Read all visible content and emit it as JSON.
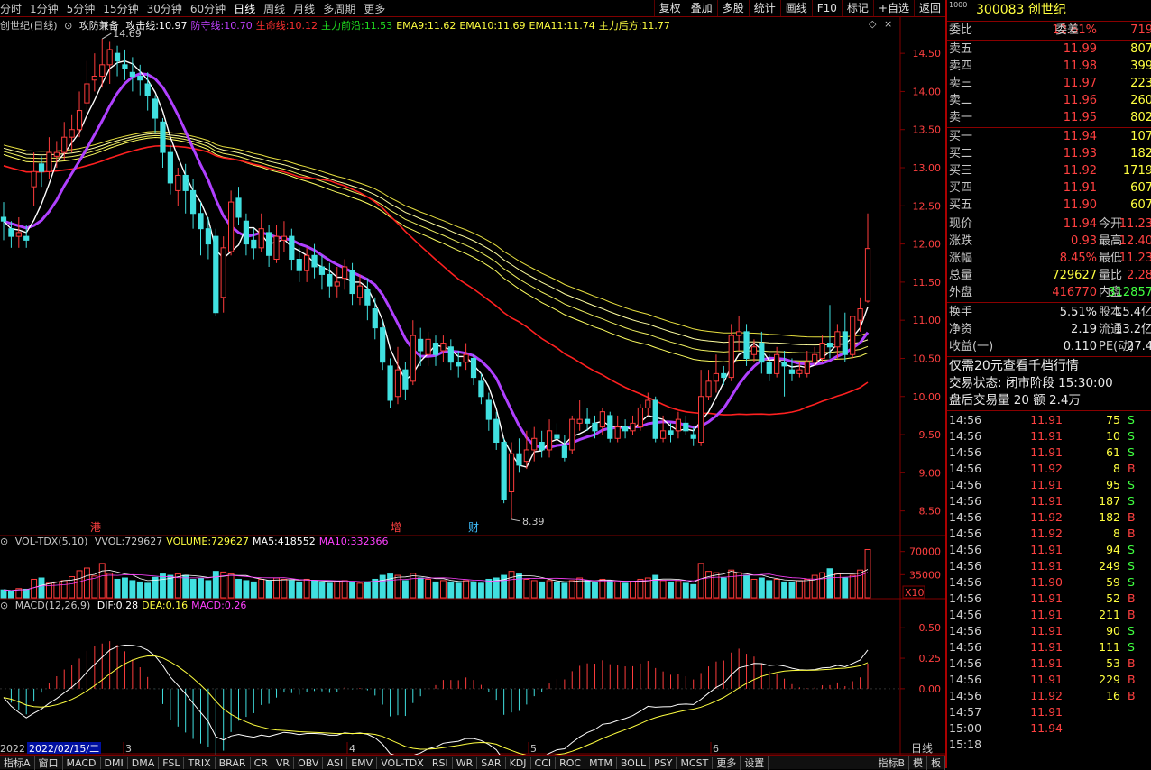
{
  "toolbar": {
    "periods": [
      "分时",
      "1分钟",
      "5分钟",
      "15分钟",
      "30分钟",
      "60分钟",
      "日线",
      "周线",
      "月线",
      "多周期",
      "更多"
    ],
    "active_period": "日线",
    "actions": [
      "复权",
      "叠加",
      "多股",
      "统计",
      "画线",
      "F10",
      "标记",
      "+自选",
      "返回"
    ]
  },
  "indicator_line": {
    "stock": "创世纪(日线)",
    "formula": "攻防兼备",
    "items": [
      {
        "label": "攻击线:",
        "value": "10.97",
        "color": "#ffffff"
      },
      {
        "label": "防守线:",
        "value": "10.70",
        "color": "#c040ff"
      },
      {
        "label": "生命线:",
        "value": "10.12",
        "color": "#ff3030"
      },
      {
        "label": "主力前沿:",
        "value": "11.53",
        "color": "#20e020"
      },
      {
        "label": "EMA9:",
        "value": "11.62",
        "color": "#ffff40"
      },
      {
        "label": "EMA10:",
        "value": "11.69",
        "color": "#ffff40"
      },
      {
        "label": "EMA11:",
        "value": "11.74",
        "color": "#ffff40"
      },
      {
        "label": "主力后方:",
        "value": "11.77",
        "color": "#ffff40"
      }
    ]
  },
  "chart_data": [
    {
      "type": "candlestick",
      "name": "main",
      "ylim": [
        8.2,
        14.75
      ],
      "y_ticks": [
        "14.50",
        "14.00",
        "13.50",
        "13.00",
        "12.50",
        "12.00",
        "11.50",
        "11.00",
        "10.50",
        "10.00",
        "9.50",
        "9.00",
        "8.50"
      ],
      "tick_values": [
        14.5,
        14.0,
        13.5,
        13.0,
        12.5,
        12.0,
        11.5,
        11.0,
        10.5,
        10.0,
        9.5,
        9.0,
        8.5
      ],
      "annotations": [
        {
          "text": "14.69",
          "value": 14.69
        },
        {
          "text": "8.39",
          "value": 8.39
        }
      ],
      "markers": [
        "港",
        "增",
        "财"
      ],
      "x_labels": [
        "3",
        "4",
        "5",
        "6"
      ],
      "candles": [
        [
          12.35,
          12.3,
          12.55,
          12.05
        ],
        [
          12.2,
          12.1,
          12.3,
          11.95
        ],
        [
          12.1,
          12.15,
          12.35,
          11.95
        ],
        [
          12.1,
          12.05,
          12.25,
          11.95
        ],
        [
          12.75,
          12.95,
          13.2,
          12.5
        ],
        [
          13.05,
          12.95,
          13.15,
          12.75
        ],
        [
          12.95,
          13.2,
          13.4,
          12.85
        ],
        [
          13.15,
          13.2,
          13.35,
          13.0
        ],
        [
          13.2,
          13.4,
          13.6,
          13.1
        ],
        [
          13.4,
          13.5,
          13.7,
          13.2
        ],
        [
          13.5,
          13.75,
          14.0,
          13.4
        ],
        [
          13.85,
          14.1,
          14.4,
          13.6
        ],
        [
          14.15,
          14.2,
          14.5,
          14.0
        ],
        [
          14.2,
          14.35,
          14.69,
          14.05
        ],
        [
          14.35,
          14.55,
          14.65,
          14.1
        ],
        [
          14.5,
          14.4,
          14.6,
          14.2
        ],
        [
          14.35,
          14.3,
          14.55,
          14.15
        ],
        [
          14.25,
          14.2,
          14.45,
          14.0
        ],
        [
          14.2,
          14.15,
          14.35,
          13.95
        ],
        [
          14.1,
          13.95,
          14.25,
          13.75
        ],
        [
          13.9,
          13.65,
          13.95,
          13.45
        ],
        [
          13.6,
          13.2,
          13.65,
          13.0
        ],
        [
          13.2,
          12.8,
          13.3,
          12.65
        ],
        [
          12.7,
          12.9,
          13.0,
          12.5
        ],
        [
          12.9,
          12.7,
          13.05,
          12.4
        ],
        [
          12.7,
          12.4,
          12.85,
          12.2
        ],
        [
          12.4,
          12.2,
          12.55,
          11.85
        ],
        [
          12.2,
          12.0,
          12.35,
          11.8
        ],
        [
          12.1,
          11.1,
          12.2,
          11.05
        ],
        [
          11.3,
          11.95,
          12.1,
          11.1
        ],
        [
          11.9,
          12.55,
          12.7,
          11.85
        ],
        [
          12.6,
          12.35,
          12.75,
          12.25
        ],
        [
          12.3,
          12.0,
          12.4,
          11.85
        ],
        [
          12.05,
          11.95,
          12.2,
          11.8
        ],
        [
          11.95,
          12.2,
          12.4,
          11.9
        ],
        [
          12.15,
          11.85,
          12.25,
          11.7
        ],
        [
          11.8,
          12.1,
          12.25,
          11.75
        ],
        [
          12.05,
          12.1,
          12.3,
          11.9
        ],
        [
          12.1,
          11.8,
          12.2,
          11.65
        ],
        [
          11.8,
          11.65,
          11.95,
          11.5
        ],
        [
          11.65,
          11.85,
          11.95,
          11.5
        ],
        [
          11.85,
          11.7,
          12.0,
          11.55
        ],
        [
          11.7,
          11.6,
          11.85,
          11.4
        ],
        [
          11.6,
          11.45,
          11.75,
          11.3
        ],
        [
          11.45,
          11.5,
          11.7,
          11.3
        ],
        [
          11.55,
          11.7,
          11.8,
          11.4
        ],
        [
          11.65,
          11.35,
          11.75,
          11.2
        ],
        [
          11.3,
          11.45,
          11.6,
          11.2
        ],
        [
          11.4,
          11.2,
          11.55,
          11.0
        ],
        [
          11.15,
          10.9,
          11.3,
          10.75
        ],
        [
          10.9,
          10.45,
          11.0,
          10.35
        ],
        [
          10.4,
          9.95,
          10.5,
          9.85
        ],
        [
          10.0,
          10.35,
          10.65,
          9.9
        ],
        [
          10.35,
          10.1,
          10.45,
          9.95
        ],
        [
          10.2,
          10.8,
          11.0,
          10.15
        ],
        [
          10.75,
          10.6,
          10.9,
          10.4
        ],
        [
          10.55,
          10.75,
          10.85,
          10.4
        ],
        [
          10.7,
          10.55,
          10.8,
          10.4
        ],
        [
          10.6,
          10.7,
          10.8,
          10.45
        ],
        [
          10.65,
          10.45,
          10.75,
          10.35
        ],
        [
          10.45,
          10.4,
          10.6,
          10.25
        ],
        [
          10.45,
          10.55,
          10.7,
          10.35
        ],
        [
          10.5,
          10.25,
          10.55,
          10.15
        ],
        [
          10.2,
          10.0,
          10.3,
          9.9
        ],
        [
          9.95,
          9.7,
          10.05,
          9.55
        ],
        [
          9.7,
          9.4,
          9.8,
          9.3
        ],
        [
          9.4,
          8.65,
          9.45,
          8.6
        ],
        [
          8.75,
          9.25,
          9.4,
          8.39
        ],
        [
          9.25,
          9.1,
          9.45,
          9.0
        ],
        [
          9.15,
          9.3,
          9.55,
          9.05
        ],
        [
          9.3,
          9.45,
          9.6,
          9.15
        ],
        [
          9.4,
          9.3,
          9.55,
          9.2
        ],
        [
          9.3,
          9.55,
          9.7,
          9.2
        ],
        [
          9.5,
          9.45,
          9.65,
          9.35
        ],
        [
          9.35,
          9.2,
          9.5,
          9.15
        ],
        [
          9.3,
          9.7,
          9.75,
          9.25
        ],
        [
          9.65,
          9.7,
          9.95,
          9.55
        ],
        [
          9.7,
          9.65,
          9.85,
          9.55
        ],
        [
          9.65,
          9.55,
          9.75,
          9.45
        ],
        [
          9.6,
          9.8,
          9.85,
          9.5
        ],
        [
          9.75,
          9.45,
          9.8,
          9.4
        ],
        [
          9.45,
          9.6,
          9.75,
          9.4
        ],
        [
          9.6,
          9.55,
          9.7,
          9.45
        ],
        [
          9.55,
          9.65,
          9.75,
          9.5
        ],
        [
          9.6,
          9.85,
          9.9,
          9.55
        ],
        [
          9.85,
          9.95,
          10.05,
          9.75
        ],
        [
          9.95,
          9.45,
          10.0,
          9.4
        ],
        [
          9.45,
          9.55,
          9.75,
          9.4
        ],
        [
          9.55,
          9.5,
          9.65,
          9.4
        ],
        [
          9.55,
          9.7,
          9.8,
          9.45
        ],
        [
          9.65,
          9.55,
          9.75,
          9.5
        ],
        [
          9.5,
          9.45,
          9.6,
          9.35
        ],
        [
          9.4,
          10.0,
          10.35,
          9.35
        ],
        [
          10.0,
          10.2,
          10.35,
          9.95
        ],
        [
          10.2,
          10.3,
          10.55,
          10.05
        ],
        [
          10.3,
          10.25,
          10.4,
          10.15
        ],
        [
          10.25,
          10.8,
          10.95,
          10.2
        ],
        [
          10.8,
          10.85,
          11.05,
          10.6
        ],
        [
          10.85,
          10.5,
          10.95,
          10.4
        ],
        [
          10.55,
          10.65,
          10.75,
          10.45
        ],
        [
          10.7,
          10.45,
          10.85,
          10.3
        ],
        [
          10.45,
          10.3,
          10.55,
          10.2
        ],
        [
          10.3,
          10.55,
          10.65,
          10.25
        ],
        [
          10.45,
          10.4,
          10.6,
          10.0
        ],
        [
          10.35,
          10.3,
          10.5,
          10.2
        ],
        [
          10.3,
          10.35,
          10.45,
          10.25
        ],
        [
          10.3,
          10.45,
          10.6,
          10.25
        ],
        [
          10.45,
          10.55,
          10.65,
          10.4
        ],
        [
          10.5,
          10.7,
          10.8,
          10.45
        ],
        [
          10.7,
          10.65,
          11.2,
          10.5
        ],
        [
          10.65,
          10.85,
          10.95,
          10.5
        ],
        [
          10.85,
          10.55,
          11.1,
          10.45
        ],
        [
          10.55,
          11.05,
          11.05,
          10.5
        ],
        [
          11.0,
          11.15,
          11.3,
          10.85
        ],
        [
          11.25,
          11.94,
          12.4,
          11.23
        ]
      ]
    },
    {
      "type": "bar",
      "name": "volume",
      "title": "VOL-TDX(5,10)",
      "ylim": [
        0,
        75000
      ],
      "y_ticks": [
        "70000",
        "35000"
      ],
      "tick_values": [
        70000,
        35000
      ],
      "unit": "X10",
      "legend": [
        {
          "label": "VVOL:",
          "value": "729627",
          "color": "#c8c8c8"
        },
        {
          "label": "VOLUME:",
          "value": "729627",
          "color": "#ffff40"
        },
        {
          "label": "MA5:",
          "value": "418552",
          "color": "#ffffff"
        },
        {
          "label": "MA10:",
          "value": "332366",
          "color": "#ff40ff"
        }
      ],
      "values": [
        12000,
        10000,
        14000,
        13000,
        28000,
        30000,
        22000,
        24000,
        26000,
        32000,
        41000,
        45000,
        33000,
        52000,
        37000,
        28000,
        30000,
        26000,
        24000,
        22000,
        31000,
        36000,
        34000,
        36000,
        34000,
        28000,
        30000,
        26000,
        40000,
        39000,
        36000,
        28000,
        26000,
        24000,
        28000,
        26000,
        30000,
        28000,
        26000,
        24000,
        28000,
        26000,
        24000,
        22000,
        24000,
        26000,
        24000,
        22000,
        24000,
        28000,
        34000,
        36000,
        34000,
        26000,
        37000,
        30000,
        28000,
        24000,
        26000,
        24000,
        22000,
        26000,
        24000,
        22000,
        28000,
        30000,
        34000,
        40000,
        36000,
        28000,
        26000,
        24000,
        26000,
        24000,
        22000,
        26000,
        30000,
        26000,
        24000,
        28000,
        26000,
        24000,
        22000,
        24000,
        28000,
        30000,
        34000,
        26000,
        24000,
        26000,
        22000,
        20000,
        52000,
        40000,
        38000,
        30000,
        42000,
        38000,
        34000,
        28000,
        30000,
        26000,
        28000,
        24000,
        24000,
        26000,
        28000,
        34000,
        38000,
        44000,
        36000,
        30000,
        34000,
        42000,
        72963
      ]
    },
    {
      "type": "bar",
      "name": "macd",
      "title": "MACD(12,26,9)",
      "ylim": [
        -0.4,
        0.62
      ],
      "y_ticks": [
        "0.50",
        "0.25",
        "0.00"
      ],
      "tick_values": [
        0.5,
        0.25,
        0
      ],
      "legend": [
        {
          "label": "DIF:",
          "value": "0.28",
          "color": "#ffffff"
        },
        {
          "label": "DEA:",
          "value": "0.16",
          "color": "#ffff40"
        },
        {
          "label": "MACD:",
          "value": "0.26",
          "color": "#ff40ff"
        }
      ]
    }
  ],
  "axis_footer": {
    "date_label": "2022/02/15/二",
    "left_label": "2022",
    "period_label": "日线"
  },
  "quote": {
    "code_name": "300083 创世纪",
    "wei_bi": {
      "label": "委比",
      "value": "12.61%",
      "label2": "委差",
      "value2": "719"
    },
    "asks": [
      {
        "label": "卖五",
        "price": "11.99",
        "vol": "807"
      },
      {
        "label": "卖四",
        "price": "11.98",
        "vol": "399"
      },
      {
        "label": "卖三",
        "price": "11.97",
        "vol": "223"
      },
      {
        "label": "卖二",
        "price": "11.96",
        "vol": "260"
      },
      {
        "label": "卖一",
        "price": "11.95",
        "vol": "802"
      }
    ],
    "bids": [
      {
        "label": "买一",
        "price": "11.94",
        "vol": "107"
      },
      {
        "label": "买二",
        "price": "11.93",
        "vol": "182"
      },
      {
        "label": "买三",
        "price": "11.92",
        "vol": "1719"
      },
      {
        "label": "买四",
        "price": "11.91",
        "vol": "607"
      },
      {
        "label": "买五",
        "price": "11.90",
        "vol": "607"
      }
    ],
    "stats": [
      {
        "l1": "现价",
        "v1": "11.94",
        "l2": "今开",
        "v2": "11.23",
        "c1": "#ff4040",
        "c2": "#ff4040"
      },
      {
        "l1": "涨跌",
        "v1": "0.93",
        "l2": "最高",
        "v2": "12.40",
        "c1": "#ff4040",
        "c2": "#ff4040"
      },
      {
        "l1": "涨幅",
        "v1": "8.45%",
        "l2": "最低",
        "v2": "11.23",
        "c1": "#ff4040",
        "c2": "#ff4040"
      },
      {
        "l1": "总量",
        "v1": "729627",
        "l2": "量比",
        "v2": "2.28",
        "c1": "#ffff40",
        "c2": "#ff4040"
      },
      {
        "l1": "外盘",
        "v1": "416770",
        "l2": "内盘",
        "v2": "312857",
        "c1": "#ff4040",
        "c2": "#40ff40"
      }
    ],
    "stats2": [
      {
        "l1": "换手",
        "v1": "5.51%",
        "l2": "股本",
        "v2": "15.4亿"
      },
      {
        "l1": "净资",
        "v1": "2.19",
        "l2": "流通",
        "v2": "13.2亿"
      },
      {
        "l1": "收益(一)",
        "v1": "0.110",
        "l2": "PE(动)",
        "v2": "27.4"
      }
    ],
    "promo": "仅需20元查看千档行情",
    "trade_status": "交易状态: 闭市阶段 15:30:00",
    "after_hours": "盘后交易量 20 额 2.4万"
  },
  "trades": [
    {
      "t": "14:56",
      "p": "11.91",
      "v": "75",
      "s": "S"
    },
    {
      "t": "14:56",
      "p": "11.91",
      "v": "10",
      "s": "S"
    },
    {
      "t": "14:56",
      "p": "11.91",
      "v": "61",
      "s": "S"
    },
    {
      "t": "14:56",
      "p": "11.92",
      "v": "8",
      "s": "B"
    },
    {
      "t": "14:56",
      "p": "11.91",
      "v": "95",
      "s": "S"
    },
    {
      "t": "14:56",
      "p": "11.91",
      "v": "187",
      "s": "S"
    },
    {
      "t": "14:56",
      "p": "11.92",
      "v": "182",
      "s": "B"
    },
    {
      "t": "14:56",
      "p": "11.92",
      "v": "8",
      "s": "B"
    },
    {
      "t": "14:56",
      "p": "11.91",
      "v": "94",
      "s": "S"
    },
    {
      "t": "14:56",
      "p": "11.91",
      "v": "249",
      "s": "S"
    },
    {
      "t": "14:56",
      "p": "11.90",
      "v": "59",
      "s": "S"
    },
    {
      "t": "14:56",
      "p": "11.91",
      "v": "52",
      "s": "B"
    },
    {
      "t": "14:56",
      "p": "11.91",
      "v": "211",
      "s": "B"
    },
    {
      "t": "14:56",
      "p": "11.91",
      "v": "90",
      "s": "S"
    },
    {
      "t": "14:56",
      "p": "11.91",
      "v": "111",
      "s": "S"
    },
    {
      "t": "14:56",
      "p": "11.91",
      "v": "53",
      "s": "B"
    },
    {
      "t": "14:56",
      "p": "11.91",
      "v": "229",
      "s": "B"
    },
    {
      "t": "14:56",
      "p": "11.92",
      "v": "16",
      "s": "B"
    },
    {
      "t": "14:57",
      "p": "11.91",
      "v": "",
      "s": ""
    },
    {
      "t": "15:00",
      "p": "11.94",
      "v": "",
      "s": ""
    },
    {
      "t": "15:18",
      "p": "",
      "v": "",
      "s": ""
    }
  ],
  "bottom_tabs": [
    "指标A",
    "窗口",
    "MACD",
    "DMI",
    "DMA",
    "FSL",
    "TRIX",
    "BRAR",
    "CR",
    "VR",
    "OBV",
    "ASI",
    "EMV",
    "VOL-TDX",
    "RSI",
    "WR",
    "SAR",
    "KDJ",
    "CCI",
    "ROC",
    "MTM",
    "BOLL",
    "PSY",
    "MCST",
    "更多",
    "设置"
  ],
  "bottom_right": [
    "指标B",
    "模",
    "板"
  ],
  "colors": {
    "up": "#ff3c3c",
    "down": "#40e0e0",
    "grid": "#800000",
    "bg": "#000000"
  }
}
